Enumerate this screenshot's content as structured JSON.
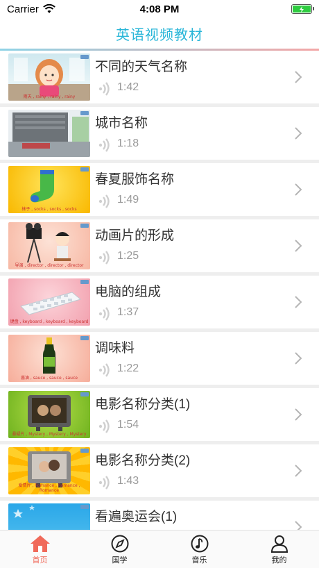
{
  "status": {
    "carrier": "Carrier",
    "time": "4:08 PM"
  },
  "nav": {
    "title": "英语视频教材"
  },
  "videos": [
    {
      "title": "不同的天气名称",
      "duration": "1:42",
      "caption": "雨天 , rainy , rainy , rainy"
    },
    {
      "title": "城市名称",
      "duration": "1:18",
      "caption": ""
    },
    {
      "title": "春夏服饰名称",
      "duration": "1:49",
      "caption": "袜子 , socks , socks , socks"
    },
    {
      "title": "动画片的形成",
      "duration": "1:25",
      "caption": "导演 , director , director , director"
    },
    {
      "title": "电脑的组成",
      "duration": "1:37",
      "caption": "键盘 , keyboard , keyboard , keyboard"
    },
    {
      "title": "调味料",
      "duration": "1:22",
      "caption": "酱油 , sauce , sauce , sauce"
    },
    {
      "title": "电影名称分类(1)",
      "duration": "1:54",
      "caption": "悬疑片 , Mystery , Mystery , Mystery"
    },
    {
      "title": "电影名称分类(2)",
      "duration": "1:43",
      "caption": "爱情片 , Romance , Romance , Romance"
    },
    {
      "title": "看遍奥运会(1)",
      "duration": "",
      "caption": ""
    }
  ],
  "tabs": [
    {
      "label": "首页",
      "icon": "home-icon",
      "active": true
    },
    {
      "label": "国学",
      "icon": "compass-icon",
      "active": false
    },
    {
      "label": "音乐",
      "icon": "music-note-icon",
      "active": false
    },
    {
      "label": "我的",
      "icon": "person-icon",
      "active": false
    }
  ],
  "colors": {
    "accent": "#29b6d8",
    "active_tab": "#f06a5a"
  }
}
